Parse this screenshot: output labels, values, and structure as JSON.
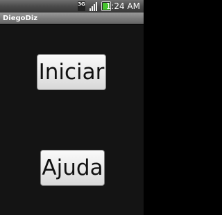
{
  "status_bar": {
    "network_label": "3G",
    "clock": "1:24 AM",
    "battery_color": "#47c52f",
    "icons": [
      "3g-icon",
      "signal-icon",
      "battery-icon"
    ]
  },
  "app": {
    "title": "DiegoDiz"
  },
  "buttons": {
    "start_label": "Iniciar",
    "help_label": "Ajuda"
  }
}
